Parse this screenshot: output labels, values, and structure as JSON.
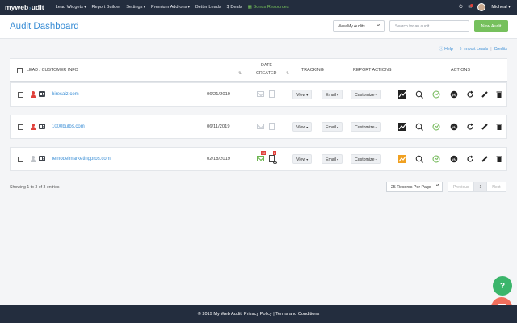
{
  "nav": {
    "logo_a": "myweb",
    "logo_b": "₂",
    "logo_c": "udit",
    "items": [
      "Lead Widgets",
      "Report Builder",
      "Settings",
      "Premium Add-ons",
      "Better Leads",
      "$ Deals",
      "Bonus Resources"
    ],
    "user": "Micheal",
    "notif_count": "1"
  },
  "header": {
    "title": "Audit Dashboard",
    "view_select": "View My Audits",
    "search_placeholder": "Search for an audit",
    "new_button": "New Audit"
  },
  "links": {
    "help": "Help",
    "import": "Import Leads",
    "credits": "Credits",
    "sep": "|"
  },
  "table": {
    "headers": {
      "lead": "Lead / Customer Info",
      "date_line1": "Date",
      "date_line2": "Created",
      "tracking": "Tracking",
      "report_actions": "Report Actions",
      "actions": "Actions"
    },
    "rows": [
      {
        "lead": "hiresaiz.com",
        "date": "06/21/2019",
        "user_color": "#e0403a",
        "tracked": false,
        "view": "View",
        "email": "Email",
        "customize": "Customize"
      },
      {
        "lead": "1000bulbs.com",
        "date": "06/11/2019",
        "user_color": "#e0403a",
        "tracked": false,
        "view": "View",
        "email": "Email",
        "customize": "Customize"
      },
      {
        "lead": "remodelmarketingpros.com",
        "date": "02/18/2019",
        "user_color": "#bfc3c8",
        "tracked": true,
        "mail_count": "12",
        "doc_count": "2",
        "view": "View",
        "email": "Email",
        "customize": "Customize"
      }
    ]
  },
  "pagination": {
    "showing": "Showing 1 to 3 of 3 entries",
    "per_page": "25    Records Per Page",
    "prev": "Previous",
    "page": "1",
    "next": "Next"
  },
  "footer": {
    "text": "© 2019 My Web Audit. Privacy Policy | Terms and Conditions"
  },
  "colors": {
    "accent": "#3c8fd6",
    "green": "#76c05d",
    "nav_bg": "#232d3e"
  }
}
